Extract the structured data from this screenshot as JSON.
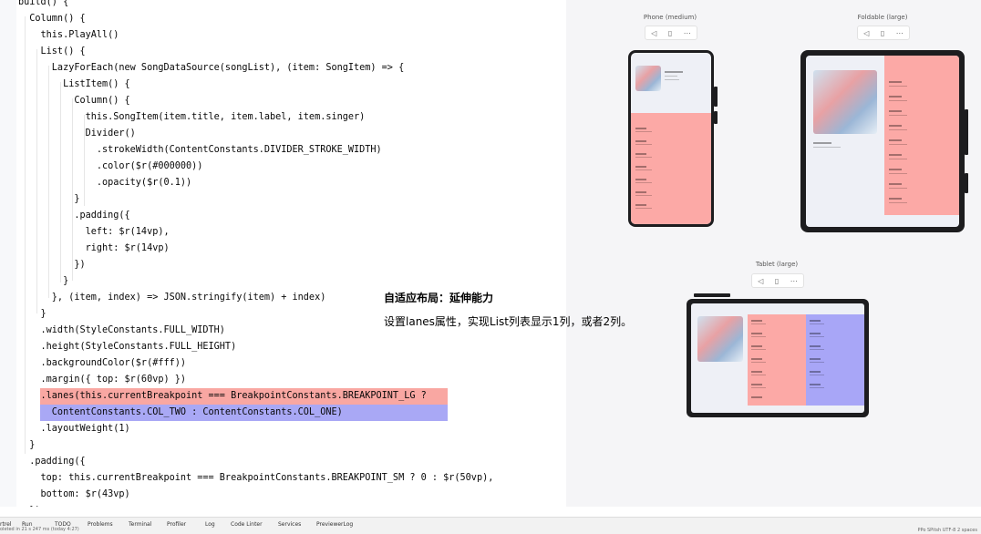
{
  "editor": {
    "lines": [
      "build() {",
      "  Column() {",
      "    this.PlayAll()",
      "    List() {",
      "      LazyForEach(new SongDataSource(songList), (item: SongItem) => {",
      "        ListItem() {",
      "          Column() {",
      "            this.SongItem(item.title, item.label, item.singer)",
      "            Divider()",
      "              .strokeWidth(ContentConstants.DIVIDER_STROKE_WIDTH)",
      "              .color($r(#000000))",
      "              .opacity($r(0.1))",
      "          }",
      "          .padding({",
      "            left: $r(14vp),",
      "            right: $r(14vp)",
      "          })",
      "        }",
      "      }, (item, index) => JSON.stringify(item) + index)",
      "    }",
      "    .width(StyleConstants.FULL_WIDTH)",
      "    .height(StyleConstants.FULL_HEIGHT)",
      "    .backgroundColor($r(#fff))",
      "    .margin({ top: $r(60vp) })",
      "    .lanes(this.currentBreakpoint === BreakpointConstants.BREAKPOINT_LG ?",
      "      ContentConstants.COL_TWO : ContentConstants.COL_ONE)",
      "    .layoutWeight(1)",
      "  }",
      "  .padding({",
      "    top: this.currentBreakpoint === BreakpointConstants.BREAKPOINT_SM ? 0 : $r(50vp),",
      "    bottom: $r(43vp)",
      "  })"
    ]
  },
  "preview": {
    "phone_title": "Phone (medium)",
    "foldable_title": "Foldable (large)",
    "tablet_title": "Tablet (large)",
    "toolbar_icons": [
      "◁",
      "▯",
      "⋯"
    ]
  },
  "description": {
    "title": "自适应布局：延伸能力",
    "body": "设置lanes属性，实现List列表显示1列，或者2列。"
  },
  "bottom_bar": {
    "items": [
      "rtrel",
      "Run",
      "TODO",
      "Problems",
      "Terminal",
      "Profiler",
      "Log",
      "Code Linter",
      "Services",
      "PreviewerLog"
    ],
    "status": "oleted in 21 s 247 ms (today 4:27)",
    "right_status": "PPo  SPitsh  UTF-8  2 spaces"
  },
  "colors": {
    "highlight_red": "#f9a7a2",
    "highlight_blue": "#a9a8f5",
    "list_pink": "#fca9a6",
    "list_purple": "#a8a6f7"
  }
}
